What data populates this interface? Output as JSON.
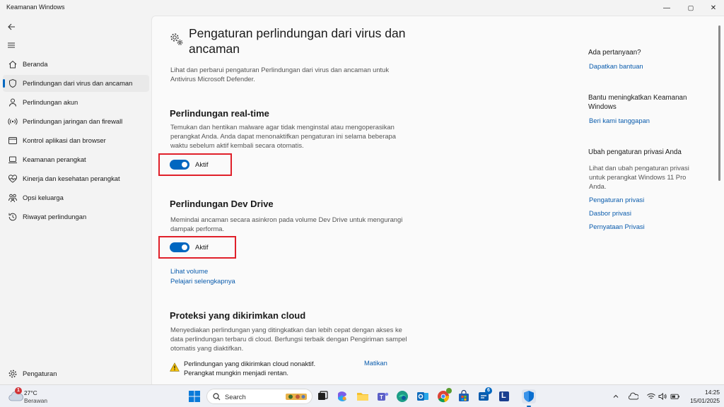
{
  "window": {
    "title": "Keamanan Windows",
    "controls": {
      "minimize": "—",
      "maximize": "▢",
      "close": "✕"
    }
  },
  "sidebar": {
    "back_icon": "back-arrow-icon",
    "menu_icon": "hamburger-icon",
    "items": [
      {
        "label": "Beranda",
        "icon": "home-icon"
      },
      {
        "label": "Perlindungan dari virus dan ancaman",
        "icon": "shield-icon",
        "active": true
      },
      {
        "label": "Perlindungan akun",
        "icon": "person-icon"
      },
      {
        "label": "Perlindungan jaringan dan firewall",
        "icon": "wifi-icon"
      },
      {
        "label": "Kontrol aplikasi dan browser",
        "icon": "app-browser-icon"
      },
      {
        "label": "Keamanan perangkat",
        "icon": "laptop-icon"
      },
      {
        "label": "Kinerja dan kesehatan perangkat",
        "icon": "heart-icon"
      },
      {
        "label": "Opsi keluarga",
        "icon": "family-icon"
      },
      {
        "label": "Riwayat perlindungan",
        "icon": "history-icon"
      }
    ],
    "settings_label": "Pengaturan"
  },
  "main": {
    "title": "Pengaturan perlindungan dari virus dan ancaman",
    "description": "Lihat dan perbarui pengaturan Perlindungan dari virus dan ancaman untuk Antivirus Microsoft Defender.",
    "realtime": {
      "title": "Perlindungan real-time",
      "description": "Temukan dan hentikan malware agar tidak menginstal atau mengoperasikan perangkat Anda. Anda dapat menonaktifkan pengaturan ini selama beberapa waktu sebelum aktif kembali secara otomatis.",
      "toggle_label": "Aktif"
    },
    "devdrive": {
      "title": "Perlindungan Dev Drive",
      "description": "Memindai ancaman secara asinkron pada volume Dev Drive untuk mengurangi dampak performa.",
      "toggle_label": "Aktif",
      "link_volume": "Lihat volume",
      "link_learn": "Pelajari selengkapnya"
    },
    "cloud": {
      "title": "Proteksi yang dikirimkan cloud",
      "description": "Menyediakan perlindungan yang ditingkatkan dan lebih cepat dengan akses ke data perlindungan terbaru di cloud. Berfungsi terbaik dengan Pengiriman sampel otomatis yang diaktifkan.",
      "warning": "Perlindungan yang dikirimkan cloud nonaktif. Perangkat mungkin menjadi rentan.",
      "action": "Matikan"
    }
  },
  "right": {
    "question_heading": "Ada pertanyaan?",
    "help_link": "Dapatkan bantuan",
    "improve_heading": "Bantu meningkatkan Keamanan Windows",
    "feedback_link": "Beri kami tanggapan",
    "privacy_heading": "Ubah pengaturan privasi Anda",
    "privacy_text": "Lihat dan ubah pengaturan privasi untuk perangkat Windows 11 Pro Anda.",
    "privacy_links": [
      "Pengaturan privasi",
      "Dasbor privasi",
      "Pernyataan Privasi"
    ]
  },
  "taskbar": {
    "weather": {
      "temp": "27°C",
      "condition": "Berawan",
      "badge": "1"
    },
    "search_placeholder": "Search",
    "badges": {
      "store": "6"
    },
    "app_letter": "L",
    "clock": {
      "time": "14:25",
      "date": "15/01/2025"
    }
  },
  "colors": {
    "accent": "#0067c0",
    "highlight": "#e0202a",
    "link": "#0a5cad"
  }
}
